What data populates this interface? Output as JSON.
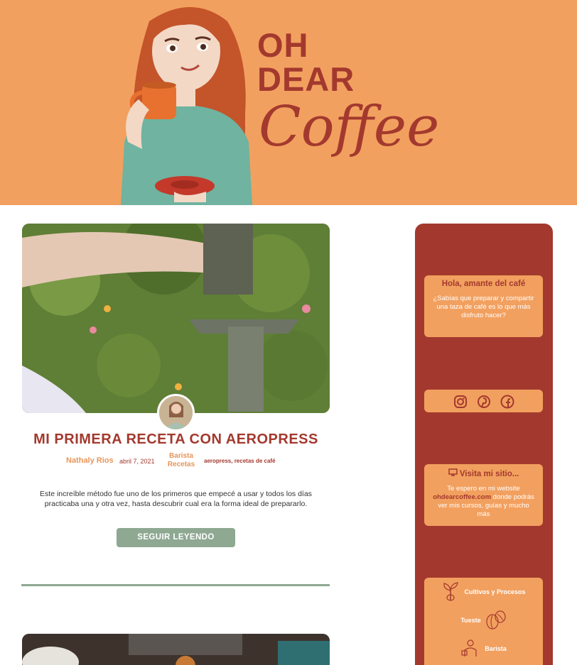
{
  "header": {
    "logo_line1": "OH",
    "logo_line2": "DEAR",
    "logo_line3": "Coffee"
  },
  "post": {
    "title": "MI PRIMERA RECETA CON AEROPRESS",
    "author": "Nathaly Rios",
    "date": "abril 7, 2021",
    "category1": "Barista",
    "category2": "Recetas",
    "tags": "aeropress, recetas de café",
    "excerpt": "Este increíble método fue uno de los primeros que empecé a usar y todos los días practicaba una y otra vez, hasta descubrir cual era la forma ideal de prepararlo.",
    "read_more": "SEGUIR LEYENDO"
  },
  "sidebar": {
    "greeting_title": "Hola, amante del café",
    "greeting_text": "¿Sabías que preparar y compartir una taza de café es lo que más disfruto hacer?",
    "social_icons": [
      "instagram-icon",
      "pinterest-icon",
      "facebook-icon"
    ],
    "visit_title": "Visita mi sitio...",
    "visit_text_before": "Te espero en mi website",
    "visit_link": "ohdearcoffee.com",
    "visit_text_after": "donde podrás ver mis cursos, guías y mucho más",
    "nav": [
      {
        "label": "Cultivos y Procesos",
        "icon": "coffee-plant-icon"
      },
      {
        "label": "Tueste",
        "icon": "coffee-beans-icon"
      },
      {
        "label": "Barista",
        "icon": "barista-icon"
      }
    ]
  },
  "colors": {
    "brand_orange": "#f2a05f",
    "brand_red": "#a3392e",
    "sage": "#8ea892"
  }
}
